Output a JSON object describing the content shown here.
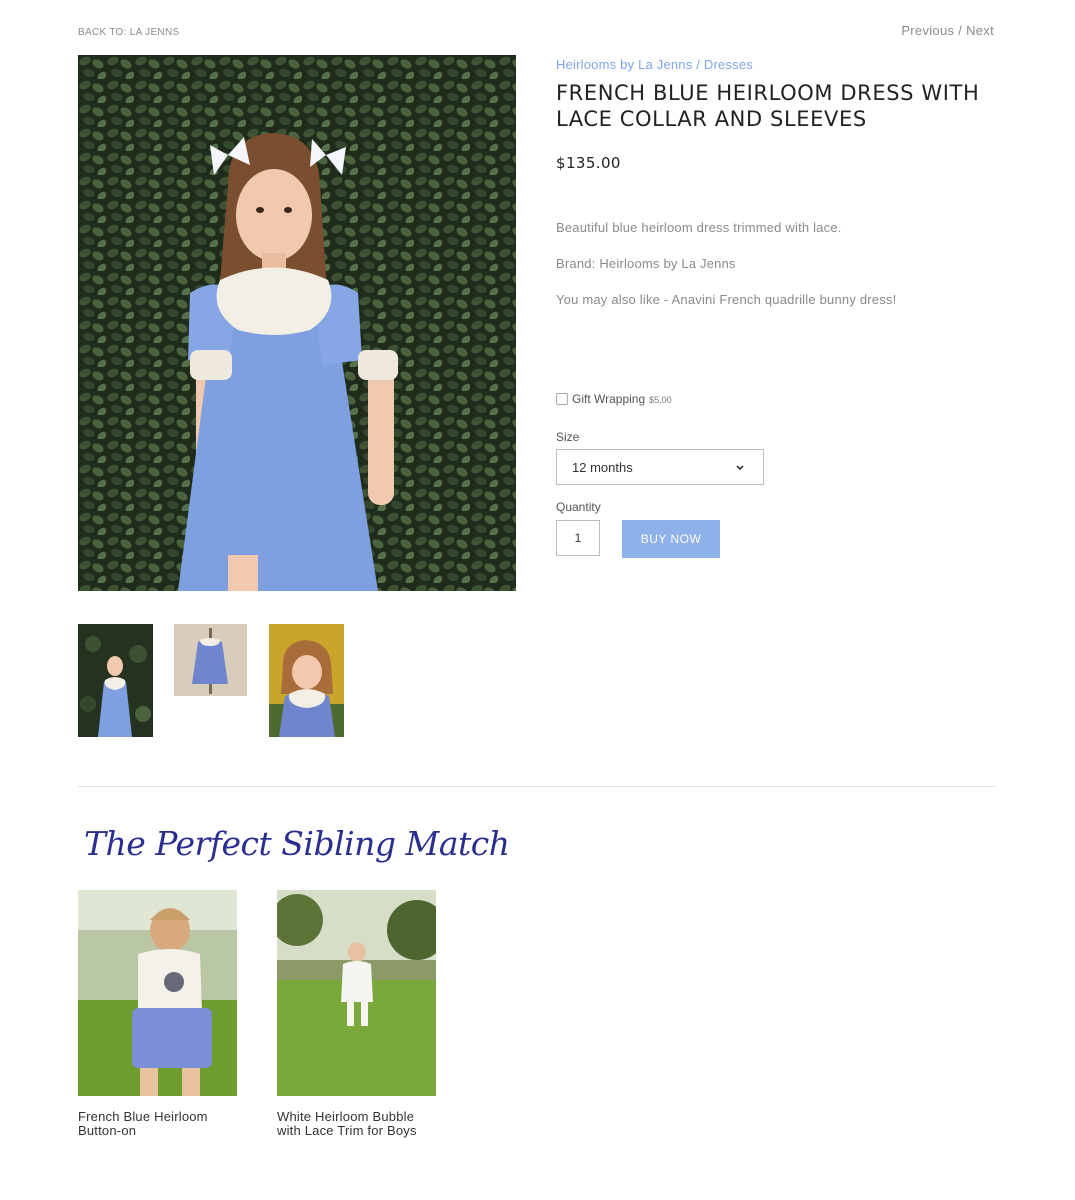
{
  "nav": {
    "back_link": "BACK TO: LA JENNS",
    "previous": "Previous",
    "separator": "/",
    "next": "Next"
  },
  "product": {
    "breadcrumb_brand": "Heirlooms by La Jenns",
    "breadcrumb_sep": " / ",
    "breadcrumb_category": "Dresses",
    "title": "FRENCH BLUE HEIRLOOM DRESS WITH LACE COLLAR AND SLEEVES",
    "price": "$135.00",
    "description": [
      "Beautiful blue heirloom dress trimmed with lace.",
      "Brand: Heirlooms by La Jenns",
      "You may also like - Anavini French quadrille bunny dress!"
    ],
    "gift_wrapping_label": "Gift Wrapping",
    "gift_wrapping_fee": "$5.00",
    "gift_wrapping_checked": false,
    "size_label": "Size",
    "size_selected": "12 months",
    "quantity_label": "Quantity",
    "quantity_value": "1",
    "buy_button": "BUY NOW"
  },
  "thumbnails": [
    {
      "icon": "girl-in-blue-dress-ivy-photo"
    },
    {
      "icon": "blue-dress-on-mannequin-photo"
    },
    {
      "icon": "smiling-girl-yellow-background-photo"
    }
  ],
  "related": {
    "heading": "The Perfect Sibling Match",
    "items": [
      {
        "name_line1": "French Blue Heirloom",
        "name_line2": "Button-on"
      },
      {
        "name_line1": "White Heirloom Bubble",
        "name_line2": "with Lace Trim for Boys"
      }
    ]
  },
  "colors": {
    "accent_link": "#7ea5e6",
    "buy_button_bg": "#8fb1ea",
    "heading_script": "#2a2f8f",
    "dress_blue": "#7e9fe0"
  }
}
